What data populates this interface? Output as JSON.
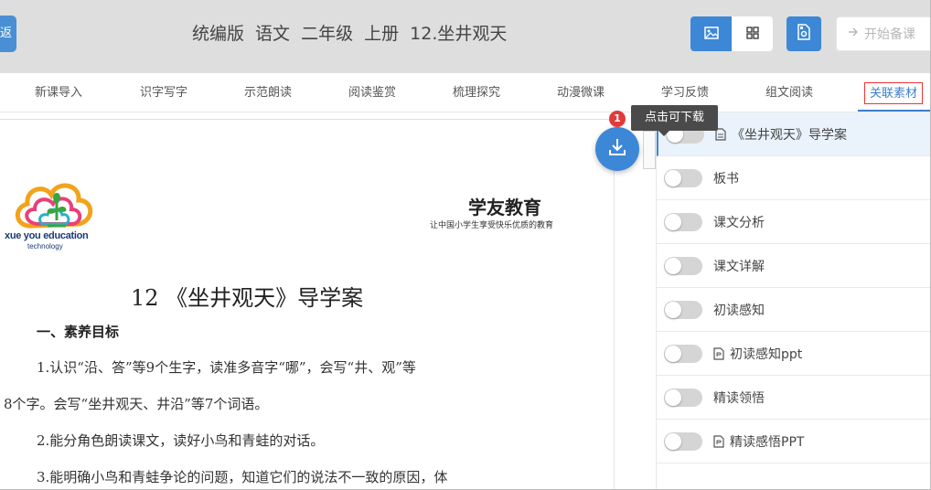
{
  "header": {
    "back_label": "返",
    "title": "统编版 语文 二年级 上册 12.坐井观天",
    "start_label": "开始备课",
    "icons": [
      "image-view-icon",
      "grid-view-icon",
      "export-icon",
      "arrow-right-icon"
    ],
    "accent": "#3c87d6"
  },
  "tabs": [
    {
      "label": "新课导入"
    },
    {
      "label": "识字写字"
    },
    {
      "label": "示范朗读"
    },
    {
      "label": "阅读鉴赏"
    },
    {
      "label": "梳理探究"
    },
    {
      "label": "动漫微课"
    },
    {
      "label": "学习反馈"
    },
    {
      "label": "组文阅读"
    },
    {
      "label": "关联素材",
      "active": true
    }
  ],
  "document": {
    "logo_text": "xue you education",
    "logo_sub": "technology",
    "brand": "学友教育",
    "brand_sub": "让中国小学生享受快乐优质的教育",
    "title": "12 《坐井观天》导学案",
    "section1": "一、素养目标",
    "lines": [
      "1.认识“沿、答”等9个生字，读准多音字“哪”，会写“井、观”等",
      "8个字。会写“坐井观天、井沿”等7个词语。",
      "2.能分角色朗读课文，读好小鸟和青蛙的对话。",
      "3.能明确小鸟和青蛙争论的问题，知道它们的说法不一致的原因，体"
    ]
  },
  "download": {
    "badge": "1",
    "tooltip": "点击可下载"
  },
  "resources": [
    {
      "label": "《坐井观天》导学案",
      "has_file_icon": true,
      "selected": true
    },
    {
      "label": "板书",
      "has_file_icon": false
    },
    {
      "label": "课文分析",
      "has_file_icon": false
    },
    {
      "label": "课文详解",
      "has_file_icon": false
    },
    {
      "label": "初读感知",
      "has_file_icon": false
    },
    {
      "label": "初读感知ppt",
      "has_file_icon": true
    },
    {
      "label": "精读领悟",
      "has_file_icon": false
    },
    {
      "label": "精读感悟PPT",
      "has_file_icon": true
    }
  ]
}
